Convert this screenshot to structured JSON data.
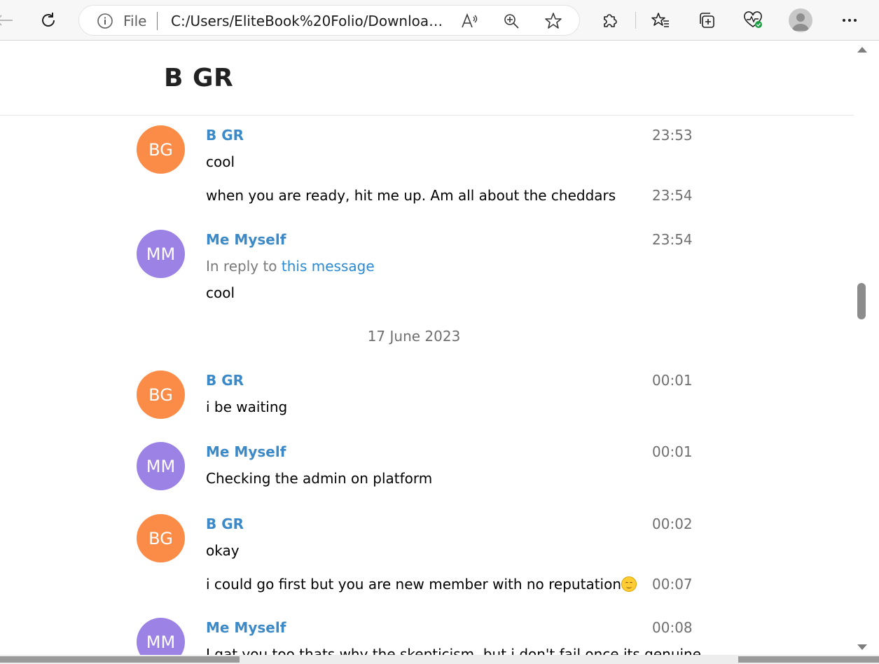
{
  "browser": {
    "address": {
      "scheme_label": "File",
      "url": "C:/Users/EliteBook%20Folio/Downloads/..."
    }
  },
  "page": {
    "title": "B GR"
  },
  "history": {
    "messages": [
      {
        "avatar": "BG",
        "from": "B GR",
        "time": "23:53",
        "text": "cool"
      },
      {
        "time": "23:54",
        "text": "when you are ready, hit me up. Am all about the cheddars"
      },
      {
        "avatar": "MM",
        "from": "Me Myself",
        "time": "23:54",
        "reply_prefix": "In reply to",
        "reply_link": "this message",
        "text": "cool"
      },
      {
        "date": "17 June 2023"
      },
      {
        "avatar": "BG",
        "from": "B GR",
        "time": "00:01",
        "text": "i be waiting"
      },
      {
        "avatar": "MM",
        "from": "Me Myself",
        "time": "00:01",
        "text": "Checking the admin on platform"
      },
      {
        "avatar": "BG",
        "from": "B GR",
        "time": "00:02",
        "text": "okay"
      },
      {
        "time": "00:07",
        "text": "i could go first but you are new member with no reputation"
      },
      {
        "avatar": "MM",
        "from": "Me Myself",
        "time": "00:08",
        "text": "I gat you too thats why the skepticism, but i don't fail once its genuine"
      }
    ]
  },
  "colors": {
    "link": "#3c89c8",
    "avatar_orange": "#fb8c47",
    "avatar_purple": "#9b82e4"
  }
}
